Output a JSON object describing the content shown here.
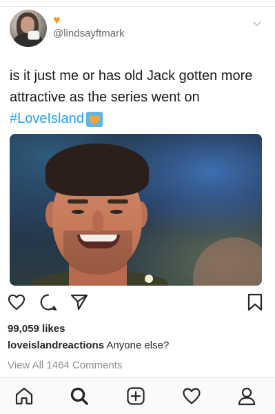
{
  "tweet": {
    "handle": "@lindsayftmark",
    "text_line1": "is it just me or has old Jack gotten more",
    "text_line2": "attractive as the series went on",
    "hashtag": "#LoveIsland"
  },
  "post": {
    "likes": "99,059 likes",
    "caption_user": "loveislandreactions",
    "caption_text": "Anyone else?",
    "view_all_comments": "View All 1464 Comments"
  },
  "icons": {
    "actions": [
      "heart-icon",
      "comment-icon",
      "share-icon",
      "bookmark-icon"
    ],
    "nav": [
      "home-icon",
      "search-icon",
      "new-post-icon",
      "activity-icon",
      "profile-icon"
    ]
  },
  "colors": {
    "hashtag": "#1da1f2",
    "emoji_heart": "#f59a23",
    "text": "#262626",
    "muted": "#8e8e8e"
  }
}
